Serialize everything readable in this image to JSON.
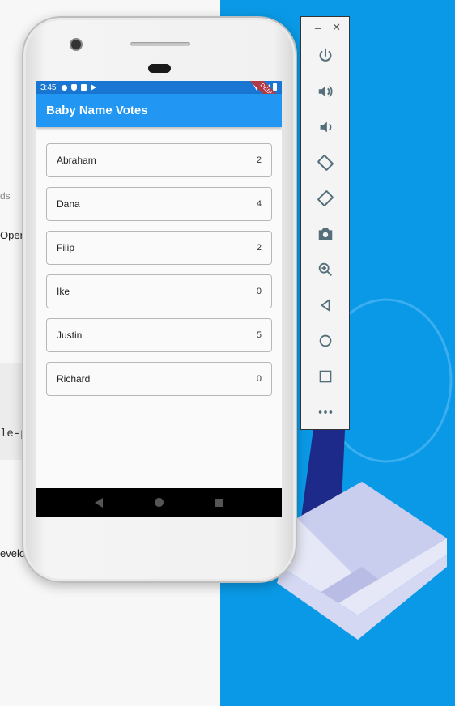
{
  "background": {
    "fragments": [
      "ds",
      "Open",
      "le-p",
      "evelop"
    ]
  },
  "phone": {
    "status_time": "3:45",
    "debug_label": "DEBUG",
    "app_title": "Baby Name Votes",
    "items": [
      {
        "name": "Abraham",
        "votes": "2"
      },
      {
        "name": "Dana",
        "votes": "4"
      },
      {
        "name": "Filip",
        "votes": "2"
      },
      {
        "name": "Ike",
        "votes": "0"
      },
      {
        "name": "Justin",
        "votes": "5"
      },
      {
        "name": "Richard",
        "votes": "0"
      }
    ]
  },
  "toolbar": {
    "minimize": "–",
    "close": "✕",
    "buttons": [
      "power-icon",
      "volume-up-icon",
      "volume-down-icon",
      "rotate-left-icon",
      "rotate-right-icon",
      "camera-icon",
      "zoom-icon",
      "back-icon",
      "home-icon",
      "overview-icon",
      "more-icon"
    ]
  },
  "colors": {
    "app_bar": "#2196f3",
    "status_bar": "#1976d2",
    "desktop_blue": "#0a99e6",
    "toolbar_icon": "#546e7a"
  }
}
